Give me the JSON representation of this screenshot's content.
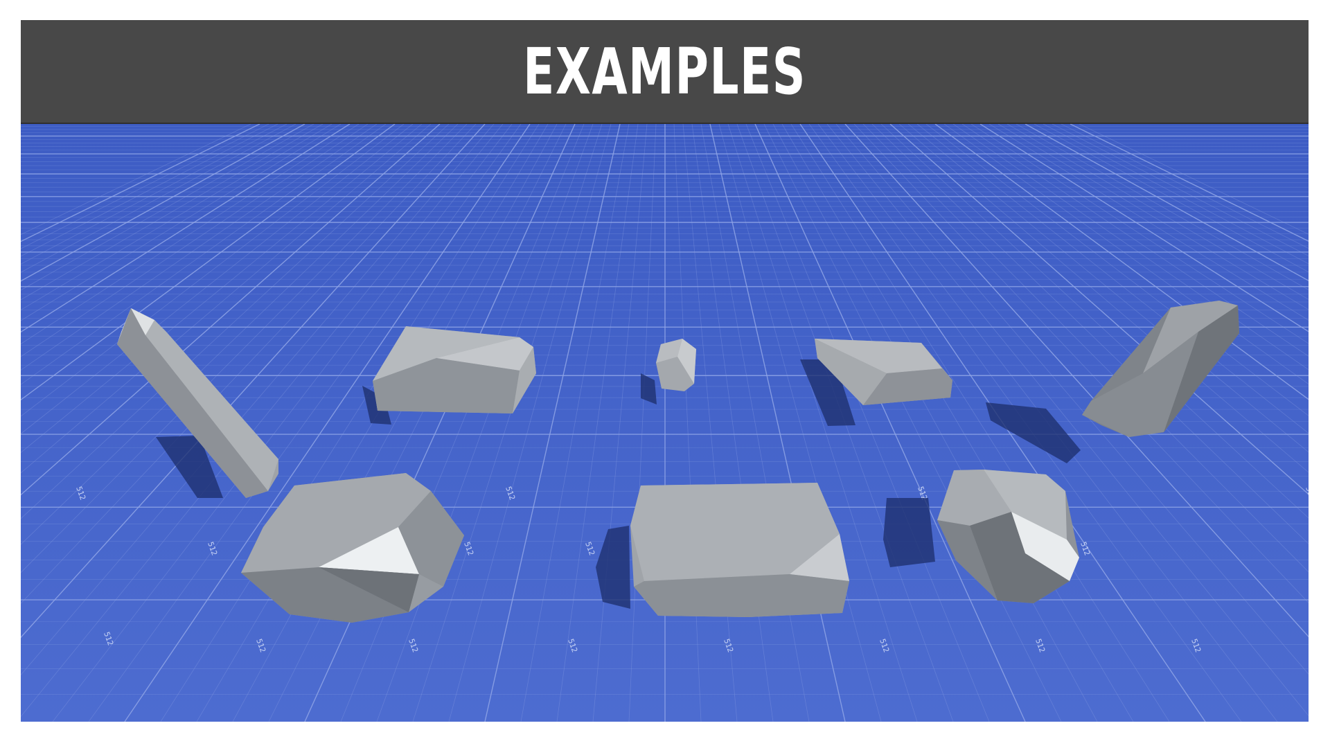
{
  "header": {
    "title": "EXAMPLES"
  },
  "scene": {
    "floor_color": "#4a68c9",
    "grid_line_color": "#8fa4e6",
    "grid_label_text": "512",
    "rock_color": "#9ea3a9",
    "shadow_color": "#1c2c66",
    "rocks": [
      {
        "name": "tall-rock-left",
        "shape": "leaning pillar"
      },
      {
        "name": "flat-rock-back-left",
        "shape": "slab"
      },
      {
        "name": "small-cube-rock",
        "shape": "small cube"
      },
      {
        "name": "flat-rock-back-right",
        "shape": "thin slab"
      },
      {
        "name": "tall-rock-right",
        "shape": "leaning pillar"
      },
      {
        "name": "boulder-front-left",
        "shape": "boulder"
      },
      {
        "name": "block-front-center",
        "shape": "block"
      },
      {
        "name": "boulder-front-right",
        "shape": "boulder"
      }
    ]
  }
}
